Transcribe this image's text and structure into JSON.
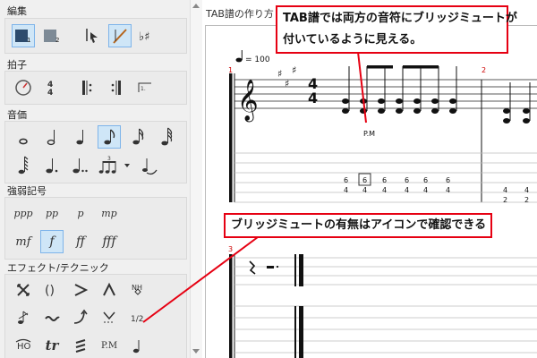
{
  "palette": {
    "groups": {
      "edit": {
        "title": "編集"
      },
      "timesig": {
        "title": "拍子"
      },
      "duration": {
        "title": "音価"
      },
      "dynamics": {
        "title": "強弱記号",
        "items": [
          "ppp",
          "pp",
          "p",
          "mp",
          "mf",
          "f",
          "ff",
          "fff"
        ]
      },
      "effects": {
        "title": "エフェクト/テクニック",
        "row3": [
          "HO",
          "tr",
          "P.M"
        ],
        "slash": "1/2"
      }
    }
  },
  "document": {
    "tab_label": "TAB譜の作り方"
  },
  "score": {
    "tempo": "= 100",
    "measure_numbers": [
      "1",
      "2",
      "3"
    ],
    "time_signature": {
      "top": "4",
      "bottom": "4"
    },
    "palm_mute_label": "P.M",
    "tab_columns": [
      {
        "top": "6",
        "bottom": "4"
      },
      {
        "top": "6",
        "bottom": "4"
      },
      {
        "top": "6",
        "bottom": "4"
      },
      {
        "top": "6",
        "bottom": "4"
      },
      {
        "top": "6",
        "bottom": "4"
      },
      {
        "top": "6",
        "bottom": "4"
      }
    ],
    "tab_columns_m2": [
      {
        "top": "4",
        "bottom": "2"
      },
      {
        "top": "4",
        "bottom": "2"
      }
    ]
  },
  "callouts": {
    "top": [
      "TAB譜では両方の音符にブリッジミュートが",
      "付いているように見える。"
    ],
    "bottom": "ブリッジミュートの有無はアイコンで確認できる"
  },
  "colors": {
    "selected": "#cfe6f7",
    "selected_border": "#7eb4ea",
    "callout_red": "#e60012"
  }
}
